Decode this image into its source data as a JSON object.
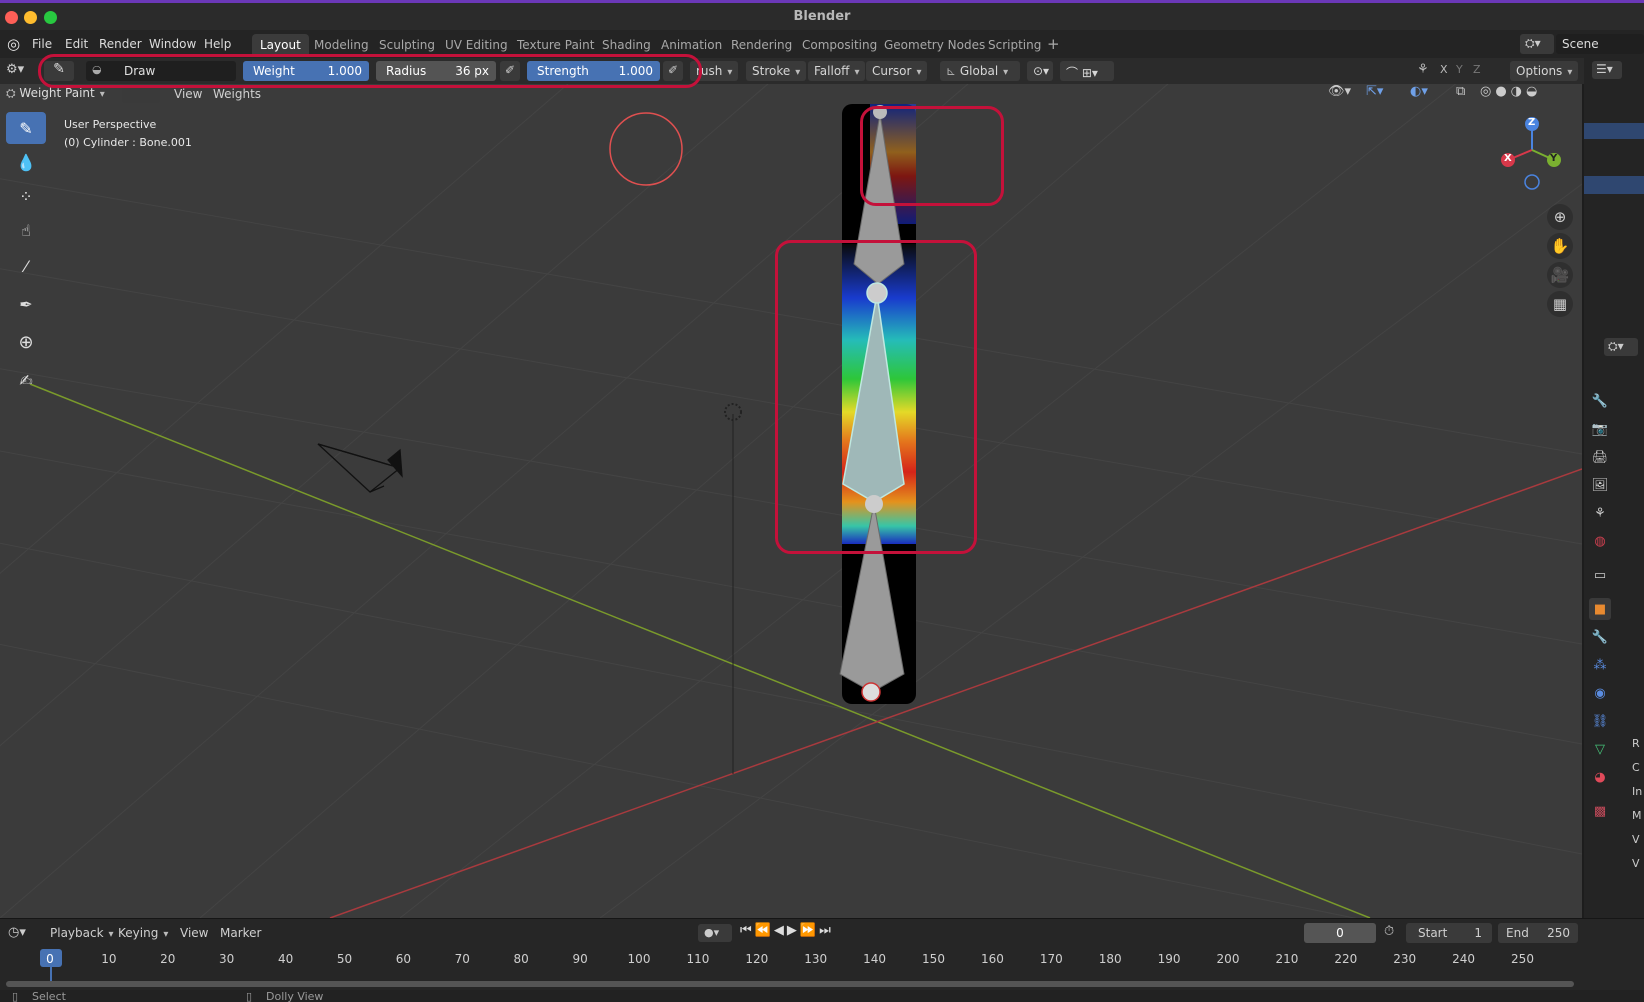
{
  "window": {
    "title": "Blender"
  },
  "menu": {
    "file": "File",
    "edit": "Edit",
    "render": "Render",
    "window": "Window",
    "help": "Help"
  },
  "workspaces": [
    "Layout",
    "Modeling",
    "Sculpting",
    "UV Editing",
    "Texture Paint",
    "Shading",
    "Animation",
    "Rendering",
    "Compositing",
    "Geometry Nodes",
    "Scripting"
  ],
  "active_workspace": "Layout",
  "scene": {
    "label": "Scene"
  },
  "toolbar": {
    "brush_name": "Draw",
    "weight_label": "Weight",
    "weight_value": "1.000",
    "radius_label": "Radius",
    "radius_value": "36 px",
    "strength_label": "Strength",
    "strength_value": "1.000",
    "brush_menu": "rush",
    "stroke_menu": "Stroke",
    "falloff_menu": "Falloff",
    "cursor_menu": "Cursor",
    "orientation": "Global",
    "axis_x": "X",
    "axis_y": "Y",
    "axis_z": "Z",
    "options": "Options"
  },
  "viewport_header": {
    "mode": "Weight Paint",
    "view_menu": "View",
    "weights_menu": "Weights"
  },
  "viewport": {
    "perspective": "User Perspective",
    "object_info": "(0) Cylinder : Bone.001",
    "gizmo_x": "X",
    "gizmo_y": "Y",
    "gizmo_z": "Z"
  },
  "timeline": {
    "playback": "Playback",
    "keying": "Keying",
    "view": "View",
    "marker": "Marker",
    "current_frame": "0",
    "start_label": "Start",
    "start_value": "1",
    "end_label": "End",
    "end_value": "250",
    "ruler": [
      "0",
      "10",
      "20",
      "30",
      "40",
      "50",
      "60",
      "70",
      "80",
      "90",
      "100",
      "110",
      "120",
      "130",
      "140",
      "150",
      "160",
      "170",
      "180",
      "190",
      "200",
      "210",
      "220",
      "230",
      "240",
      "250"
    ]
  },
  "statusbar": {
    "select": "Select",
    "dolly": "Dolly View"
  },
  "outliner_letters": [
    "R",
    "C",
    "In",
    "M",
    "V",
    "V"
  ],
  "colors": {
    "accent": "#4772b3",
    "highlight": "#c4113a",
    "title_stripe": "#6b38b8"
  }
}
